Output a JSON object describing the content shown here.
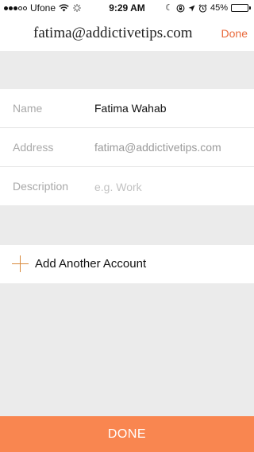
{
  "status_bar": {
    "carrier": "Ufone",
    "time": "9:29 AM",
    "battery_percent": "45%",
    "battery_level": 0.45,
    "icons": [
      "signal-dots-icon",
      "wifi-icon",
      "activity-spinner-icon",
      "moon-icon",
      "rotation-lock-icon",
      "location-arrow-icon",
      "alarm-icon",
      "battery-icon"
    ]
  },
  "header": {
    "title": "fatima@addictivetips.com",
    "done_label": "Done"
  },
  "form": {
    "name": {
      "label": "Name",
      "value": "Fatima Wahab"
    },
    "address": {
      "label": "Address",
      "value": "fatima@addictivetips.com"
    },
    "description": {
      "label": "Description",
      "placeholder": "e.g. Work",
      "value": ""
    }
  },
  "add_account": {
    "label": "Add Another Account",
    "icon": "plus-icon"
  },
  "footer": {
    "done_label": "DONE"
  },
  "colors": {
    "accent": "#e96a3c",
    "done_bar": "#f98650",
    "plus": "#d98a3d",
    "background": "#ebebeb"
  }
}
